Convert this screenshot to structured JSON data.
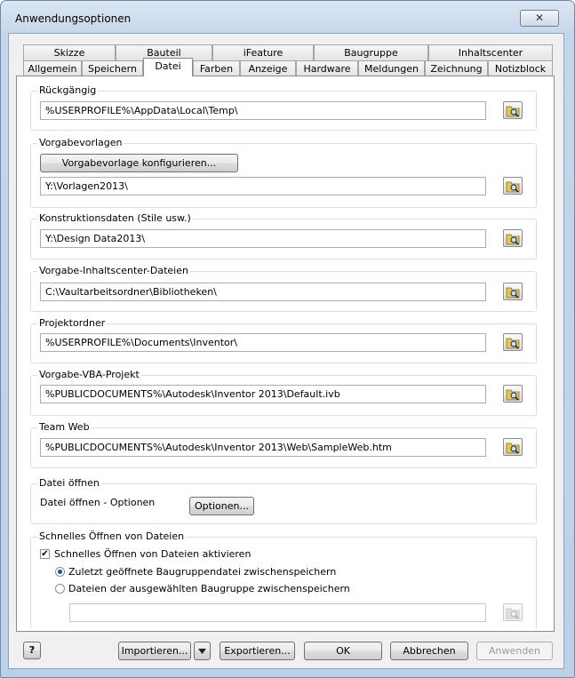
{
  "window": {
    "title": "Anwendungsoptionen",
    "close_glyph": "✕"
  },
  "tabs_row1": [
    "Skizze",
    "Bauteil",
    "iFeature",
    "Baugruppe",
    "Inhaltscenter"
  ],
  "tabs_row2": [
    "Allgemein",
    "Speichern",
    "Datei",
    "Farben",
    "Anzeige",
    "Hardware",
    "Meldungen",
    "Zeichnung",
    "Notizblock"
  ],
  "active_tab": "Datei",
  "groups": {
    "undo": {
      "label": "Rückgängig",
      "path": "%USERPROFILE%\\AppData\\Local\\Temp\\"
    },
    "templates": {
      "label": "Vorgabevorlagen",
      "configure_button": "Vorgabevorlage konfigurieren...",
      "path": "Y:\\Vorlagen2013\\"
    },
    "design_data": {
      "label": "Konstruktionsdaten (Stile usw.)",
      "path": "Y:\\Design Data2013\\"
    },
    "content_center": {
      "label": "Vorgabe-Inhaltscenter-Dateien",
      "path": "C:\\Vaultarbeitsordner\\Bibliotheken\\"
    },
    "projects": {
      "label": "Projektordner",
      "path": "%USERPROFILE%\\Documents\\Inventor\\"
    },
    "vba": {
      "label": "Vorgabe-VBA-Projekt",
      "path": "%PUBLICDOCUMENTS%\\Autodesk\\Inventor 2013\\Default.ivb"
    },
    "team_web": {
      "label": "Team Web",
      "path": "%PUBLICDOCUMENTS%\\Autodesk\\Inventor 2013\\Web\\SampleWeb.htm"
    },
    "file_open": {
      "label": "Datei öffnen",
      "options_label": "Datei öffnen - Optionen",
      "options_button": "Optionen..."
    },
    "quick_open": {
      "label": "Schnelles Öffnen von Dateien",
      "enable_label": "Schnelles Öffnen von Dateien aktivieren",
      "enable_checked": true,
      "radio_recent": "Zuletzt geöffnete Baugruppendatei zwischenspeichern",
      "radio_selected": "Dateien der ausgewählten Baugruppe zwischenspeichern",
      "selected_radio": "recent",
      "path": ""
    }
  },
  "footer": {
    "help_glyph": "?",
    "import_button": "Importieren...",
    "export_button": "Exportieren...",
    "ok_button": "OK",
    "cancel_button": "Abbrechen",
    "apply_button": "Anwenden"
  }
}
